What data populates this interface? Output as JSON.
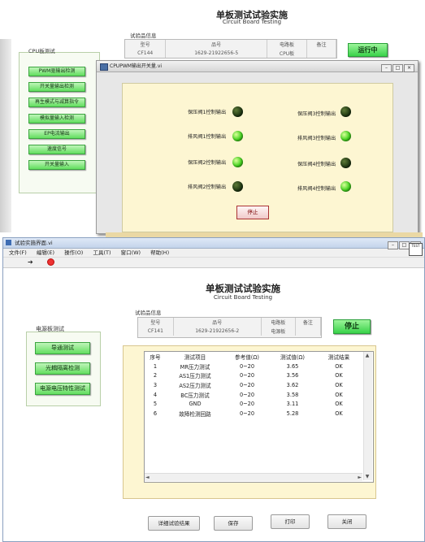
{
  "top": {
    "title": "单板测试试验实施",
    "subtitle": "Circuit Board Testing",
    "info_label": "试验品信息",
    "info_headers": [
      "型号",
      "品号",
      "电路板",
      "备注"
    ],
    "info_values": [
      "CF144",
      "1629-21922656-5",
      "CPU板",
      ""
    ],
    "run_button": "运行中",
    "panel_title": "CPU板测试",
    "side_buttons": [
      "PWM驱输出检测",
      "开关量输出检测",
      "再生模式与减算指令",
      "模拟量输入检测",
      "EP电流输出",
      "速度信号",
      "开关量输入"
    ],
    "dialog_title": "CPUPWM输出开关量.vi",
    "leds": [
      {
        "label": "保压阀1控制输出",
        "state": "off"
      },
      {
        "label": "排风阀1控制输出",
        "state": "on"
      },
      {
        "label": "保压阀2控制输出",
        "state": "on"
      },
      {
        "label": "排风阀2控制输出",
        "state": "off"
      },
      {
        "label": "保压阀3控制输出",
        "state": "off"
      },
      {
        "label": "排风阀3控制输出",
        "state": "on"
      },
      {
        "label": "保压阀4控制输出",
        "state": "off"
      },
      {
        "label": "排风阀4控制输出",
        "state": "on"
      }
    ],
    "stop_button": "停止"
  },
  "bottom": {
    "window_title": "试验实施界面.vi",
    "menu": [
      "文件(F)",
      "编辑(E)",
      "操作(O)",
      "工具(T)",
      "窗口(W)",
      "帮助(H)"
    ],
    "toolbar_icons": [
      "run-arrow-icon",
      "abort-icon"
    ],
    "title": "单板测试试验实施",
    "subtitle": "Circuit Board Testing",
    "info_label": "试验品信息",
    "info_headers": [
      "型号",
      "品号",
      "电路板",
      "备注"
    ],
    "info_values": [
      "CF141",
      "1629-21922656-2",
      "电源板",
      ""
    ],
    "stop_button": "停止",
    "panel_title": "电源板测试",
    "side_buttons": [
      "导通测试",
      "光耦隔离检测",
      "电源电压特性测试"
    ],
    "result_headers": [
      "序号",
      "测试项目",
      "参考值(Ω)",
      "测试值(Ω)",
      "测试结果"
    ],
    "results": [
      [
        "1",
        "MR压力测试",
        "0~20",
        "3.65",
        "OK"
      ],
      [
        "2",
        "AS1压力测试",
        "0~20",
        "3.56",
        "OK"
      ],
      [
        "3",
        "AS2压力测试",
        "0~20",
        "3.62",
        "OK"
      ],
      [
        "4",
        "BC压力测试",
        "0~20",
        "3.58",
        "OK"
      ],
      [
        "5",
        "GND",
        "0~20",
        "3.11",
        "OK"
      ],
      [
        "6",
        "故障检测回路",
        "0~20",
        "5.28",
        "OK"
      ]
    ],
    "bottom_buttons": [
      "详细试验结果",
      "保存",
      "打印",
      "关闭"
    ]
  }
}
